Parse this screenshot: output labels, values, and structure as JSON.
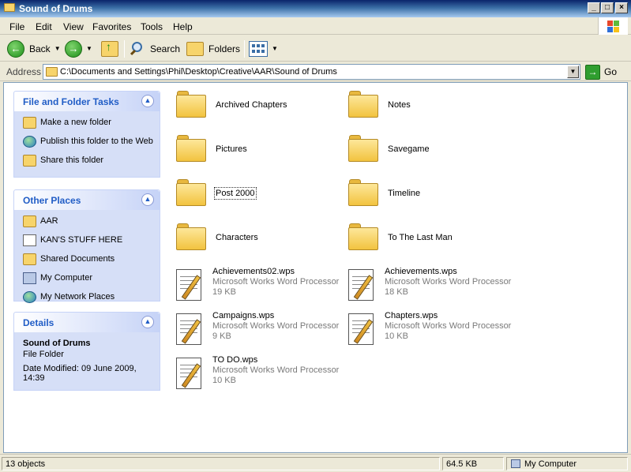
{
  "window": {
    "title": "Sound of Drums"
  },
  "menu": [
    "File",
    "Edit",
    "View",
    "Favorites",
    "Tools",
    "Help"
  ],
  "toolbar": {
    "back": "Back",
    "search": "Search",
    "folders": "Folders"
  },
  "address": {
    "label": "Address",
    "path": "C:\\Documents and Settings\\Phil\\Desktop\\Creative\\AAR\\Sound of Drums",
    "go": "Go"
  },
  "tasks": {
    "title": "File and Folder Tasks",
    "items": [
      "Make a new folder",
      "Publish this folder to the Web",
      "Share this folder"
    ]
  },
  "places": {
    "title": "Other Places",
    "items": [
      "AAR",
      "KAN'S STUFF HERE",
      "Shared Documents",
      "My Computer",
      "My Network Places"
    ]
  },
  "details": {
    "title": "Details",
    "name": "Sound of Drums",
    "type": "File Folder",
    "modified": "Date Modified: 09 June 2009, 14:39"
  },
  "folders": [
    "Archived Chapters",
    "Notes",
    "Pictures",
    "Savegame",
    "Post 2000",
    "Timeline",
    "Characters",
    "To The Last Man"
  ],
  "files": [
    {
      "name": "Achievements02.wps",
      "type": "Microsoft Works Word Processor",
      "size": "19 KB"
    },
    {
      "name": "Achievements.wps",
      "type": "Microsoft Works Word Processor",
      "size": "18 KB"
    },
    {
      "name": "Campaigns.wps",
      "type": "Microsoft Works Word Processor",
      "size": "9 KB"
    },
    {
      "name": "Chapters.wps",
      "type": "Microsoft Works Word Processor",
      "size": "10 KB"
    },
    {
      "name": "TO DO.wps",
      "type": "Microsoft Works Word Processor",
      "size": "10 KB"
    }
  ],
  "status": {
    "count": "13 objects",
    "size": "64.5 KB",
    "location": "My Computer"
  }
}
